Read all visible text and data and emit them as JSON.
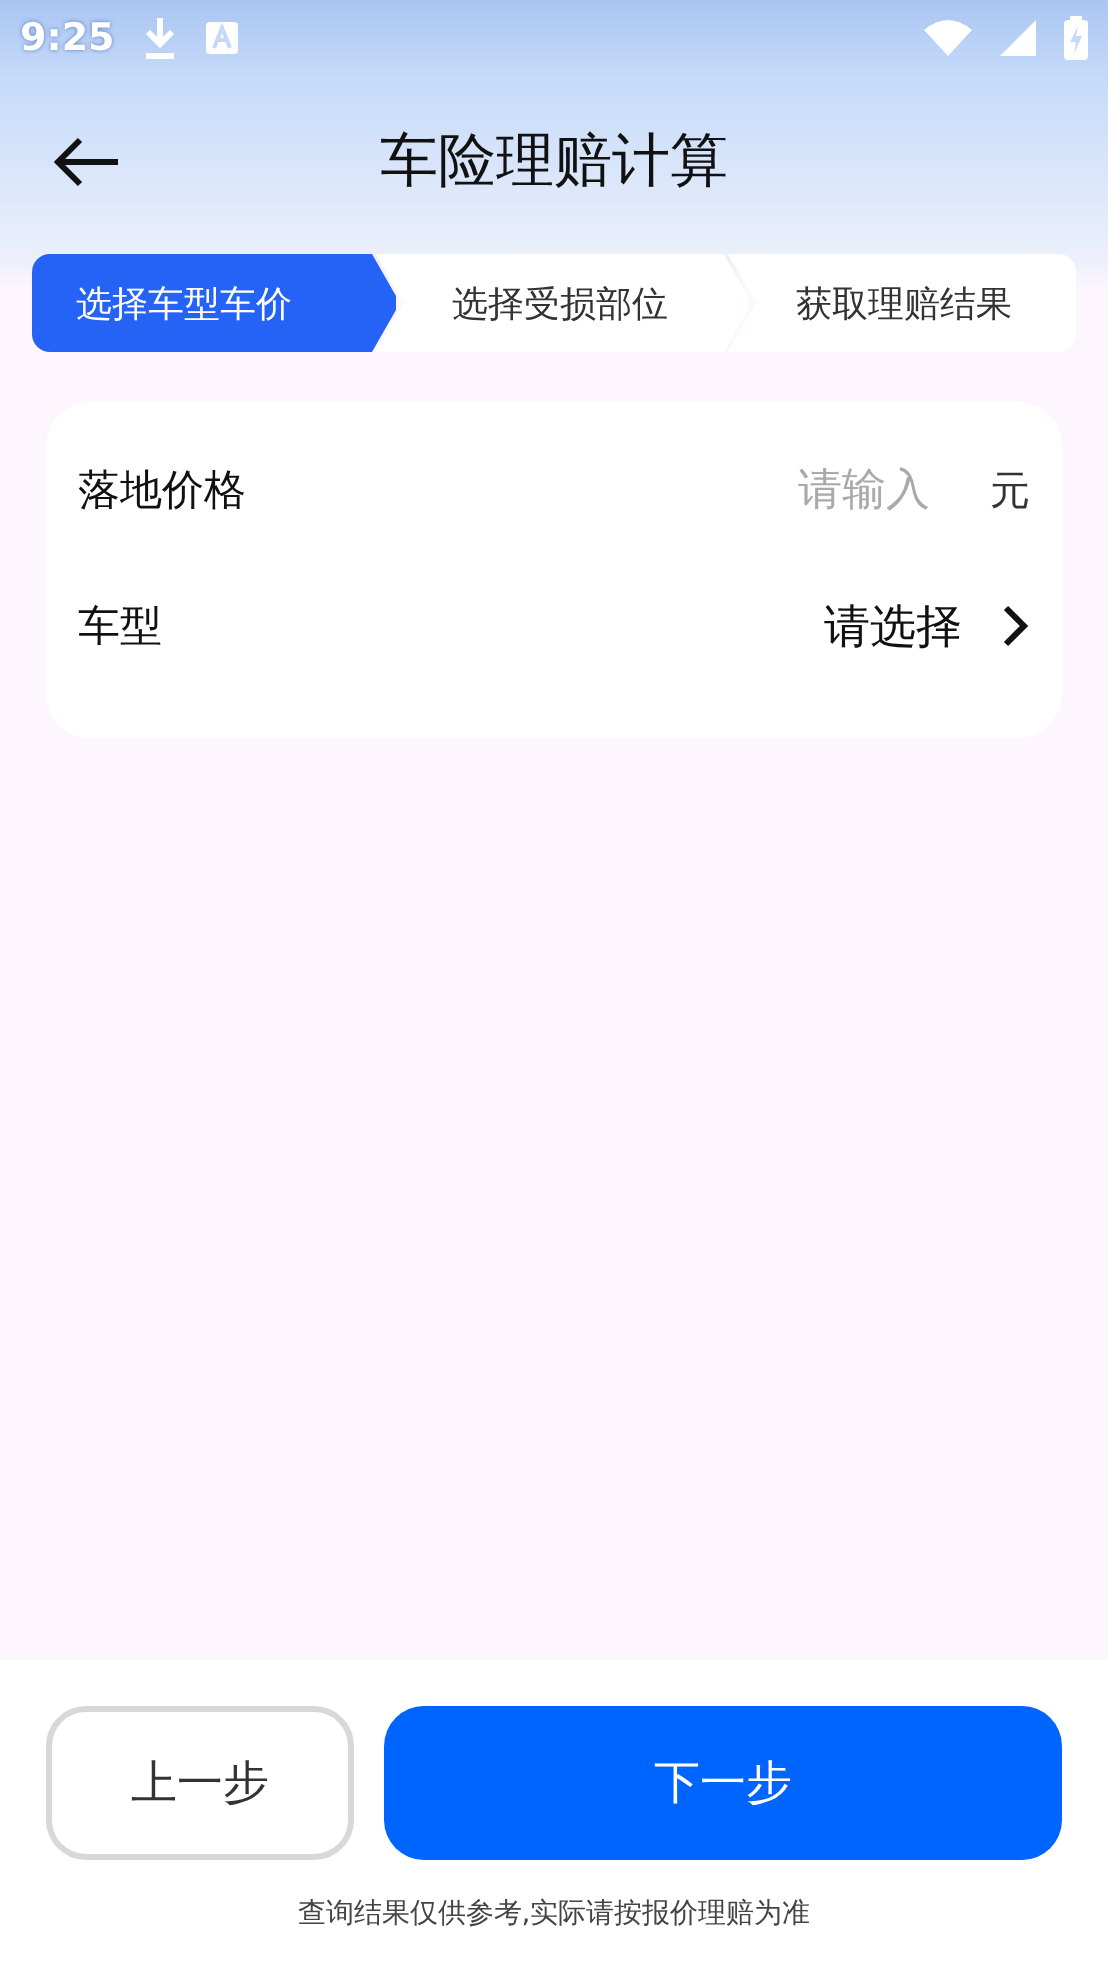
{
  "status_bar": {
    "time": "9:25"
  },
  "header": {
    "title": "车险理赔计算"
  },
  "steps": [
    {
      "label": "选择车型车价",
      "selected": true
    },
    {
      "label": "选择受损部位",
      "selected": false
    },
    {
      "label": "获取理赔结果",
      "selected": false
    }
  ],
  "form": {
    "rows": [
      {
        "kind": "input",
        "label": "落地价格",
        "placeholder": "请输入",
        "unit": "元"
      },
      {
        "kind": "select",
        "label": "车型",
        "value": "请选择"
      }
    ]
  },
  "buttons": {
    "back": "上一步",
    "next": "下一步"
  },
  "note": "查询结果仅供参考,实际请按报价理赔为准"
}
